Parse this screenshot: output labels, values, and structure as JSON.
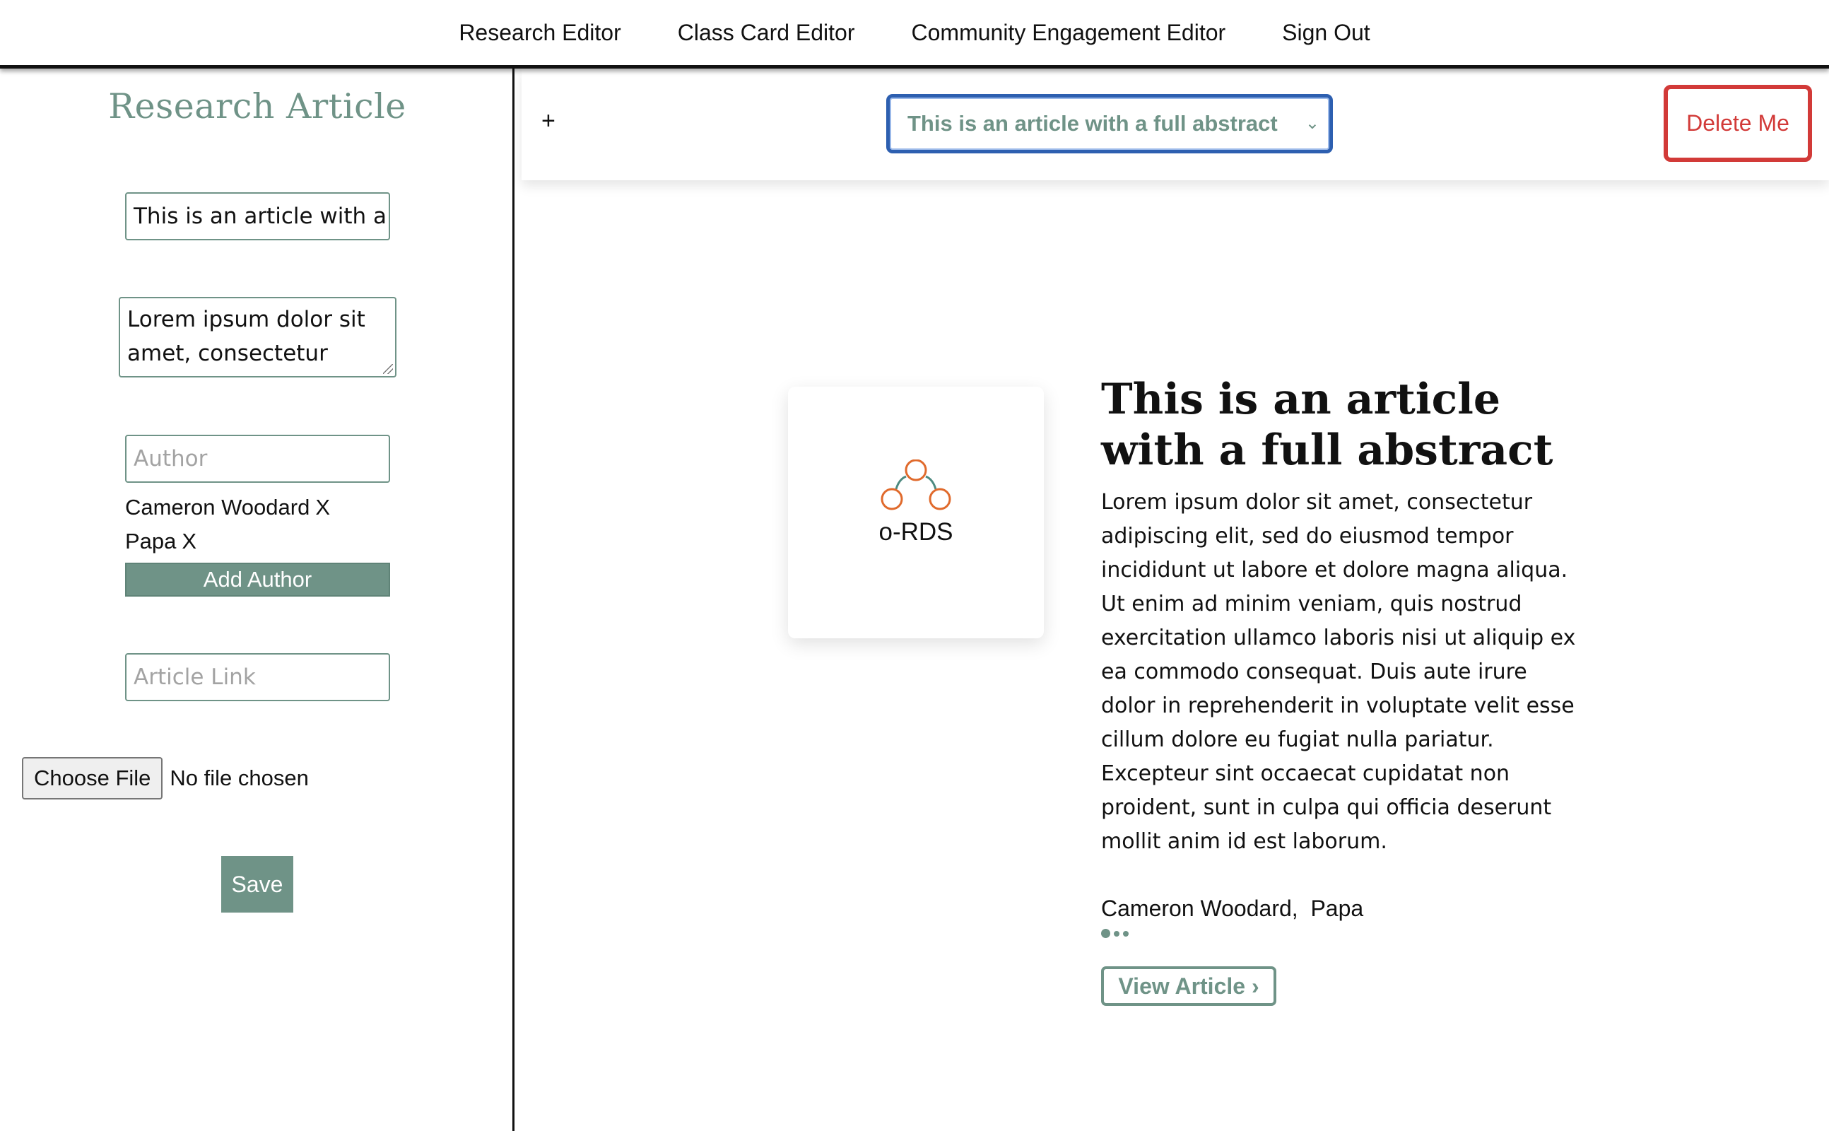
{
  "nav": {
    "items": [
      {
        "label": "Research Editor"
      },
      {
        "label": "Class Card Editor"
      },
      {
        "label": "Community Engagement Editor"
      },
      {
        "label": "Sign Out"
      }
    ]
  },
  "editor": {
    "heading": "Research Article",
    "title_value": "This is an article with a fu",
    "abstract_value": "Lorem ipsum dolor sit amet, consectetur",
    "author_placeholder": "Author",
    "authors": [
      {
        "name": "Cameron Woodard",
        "remove": "X"
      },
      {
        "name": "Papa",
        "remove": "X"
      }
    ],
    "add_author_label": "Add Author",
    "link_placeholder": "Article Link",
    "file_button_label": "Choose File",
    "file_status": "No file chosen",
    "save_label": "Save"
  },
  "toolbar": {
    "add_label": "+",
    "selected_article": "This is an article with a full abstract",
    "chevron": "⌄",
    "delete_label": "Delete Me"
  },
  "preview": {
    "logo_text": "o-RDS",
    "title": "This is an article with a full abstract",
    "abstract": "Lorem ipsum dolor sit amet, consectetur adipiscing elit, sed do eiusmod tempor incididunt ut labore et dolore magna aliqua. Ut enim ad minim veniam, quis nostrud exercitation ullamco laboris nisi ut aliquip ex ea commodo consequat. Duis aute irure dolor in reprehenderit in voluptate velit esse cillum dolore eu fugiat nulla pariatur. Excepteur sint occaecat cupidatat non proident, sunt in culpa qui officia deserunt mollit anim id est laborum.",
    "authors": "Cameron Woodard,  Papa",
    "view_label": "View Article ›"
  },
  "colors": {
    "accent": "#6f9387",
    "danger": "#d23a38",
    "focus": "#2d5fb0",
    "logo_orange": "#e06a2c",
    "logo_teal": "#4d8a80"
  }
}
